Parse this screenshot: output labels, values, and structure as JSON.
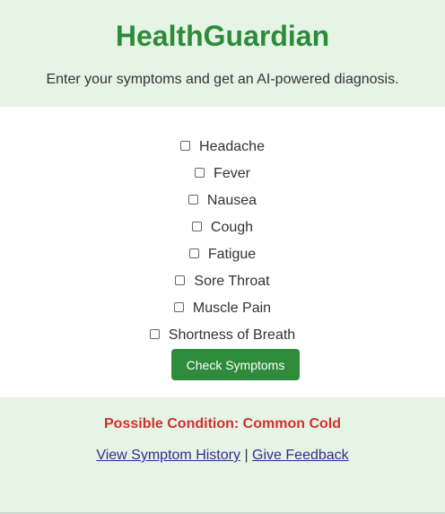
{
  "app": {
    "title": "HealthGuardian",
    "subtitle": "Enter your symptoms and get an AI-powered diagnosis."
  },
  "symptoms": [
    {
      "label": "Headache",
      "checked": false
    },
    {
      "label": "Fever",
      "checked": false
    },
    {
      "label": "Nausea",
      "checked": false
    },
    {
      "label": "Cough",
      "checked": false
    },
    {
      "label": "Fatigue",
      "checked": false
    },
    {
      "label": "Sore Throat",
      "checked": false
    },
    {
      "label": "Muscle Pain",
      "checked": false
    },
    {
      "label": "Shortness of Breath",
      "checked": false
    }
  ],
  "actions": {
    "check_label": "Check Symptoms"
  },
  "result": {
    "text": "Possible Condition: Common Cold"
  },
  "links": {
    "history_label": "View Symptom History",
    "separator": "|",
    "feedback_label": "Give Feedback"
  },
  "colors": {
    "brand": "#2e8b3a",
    "background": "#e6f4e6",
    "alert": "#d32f2f",
    "link": "#3b2a8f"
  }
}
